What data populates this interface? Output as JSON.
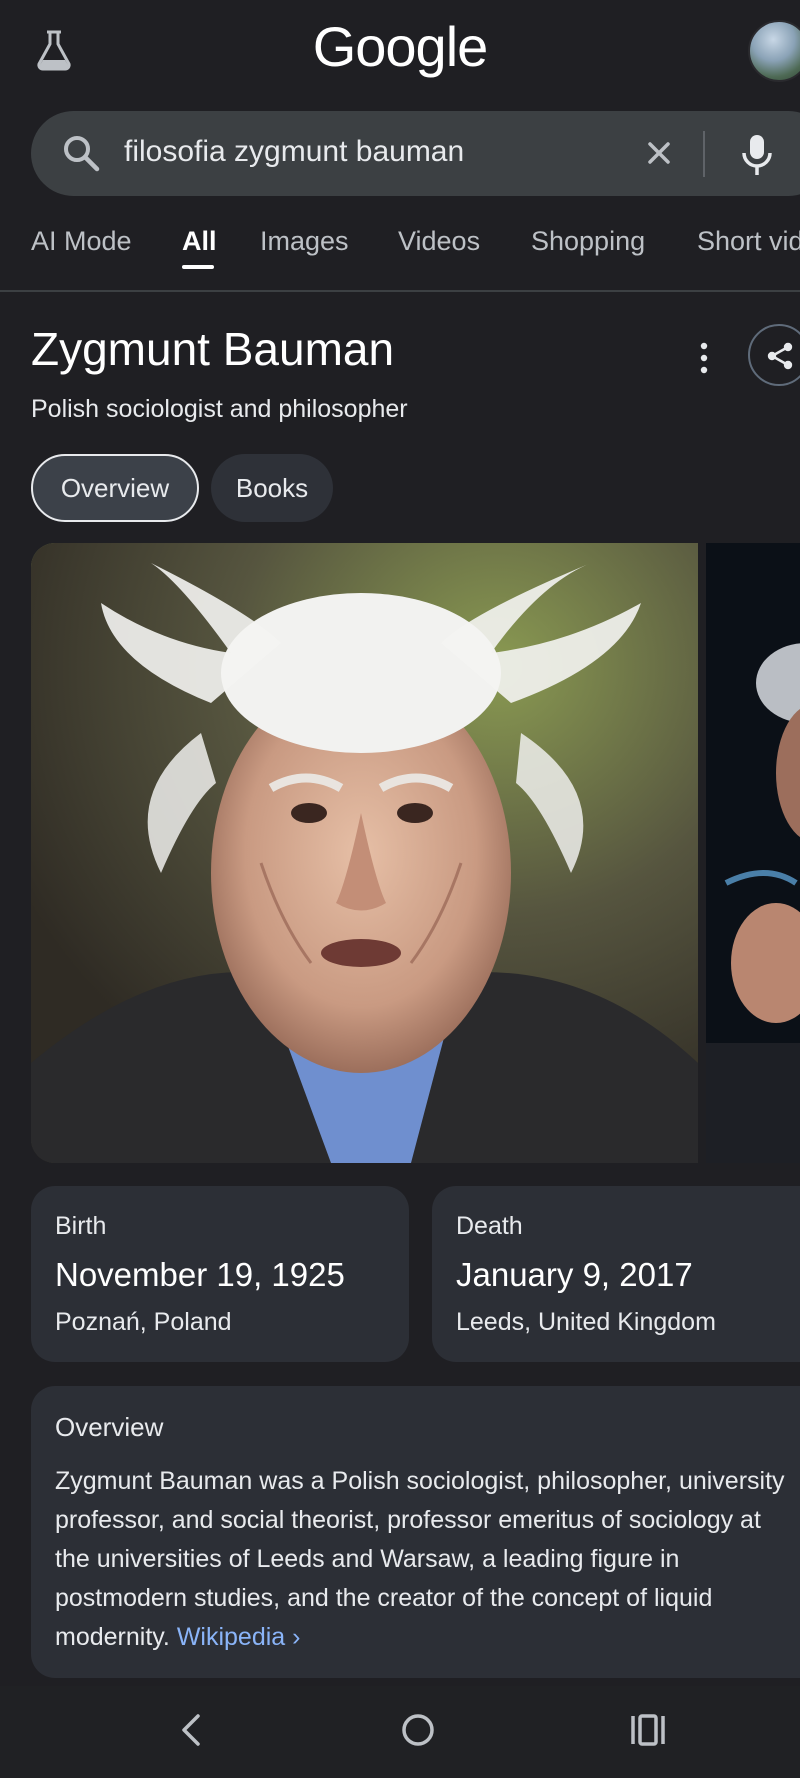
{
  "header": {
    "logo": "Google",
    "lab_icon": "flask-icon",
    "avatar": "user-avatar"
  },
  "search": {
    "query": "filosofia zygmunt bauman",
    "search_icon": "search-icon",
    "clear_icon": "close-icon",
    "mic_icon": "microphone-icon"
  },
  "tabs": [
    {
      "label": "AI Mode"
    },
    {
      "label": "All",
      "active": true
    },
    {
      "label": "Images"
    },
    {
      "label": "Videos"
    },
    {
      "label": "Shopping"
    },
    {
      "label": "Short vid"
    }
  ],
  "knowledge_panel": {
    "title": "Zygmunt Bauman",
    "subtitle": "Polish sociologist and philosopher",
    "chips": [
      {
        "label": "Overview",
        "selected": true
      },
      {
        "label": "Books"
      }
    ],
    "facts": {
      "birth": {
        "label": "Birth",
        "date": "November 19, 1925",
        "place": "Poznań, Poland"
      },
      "death": {
        "label": "Death",
        "date": "January 9, 2017",
        "place": "Leeds, United Kingdom"
      }
    },
    "overview": {
      "title": "Overview",
      "text": "Zygmunt Bauman was a Polish sociologist, philosopher, university professor, and social theorist, professor emeritus of sociology at the universities of Leeds and Warsaw, a leading figure in postmodern studies, and the creator of the concept of liquid modernity.",
      "source_link": "Wikipedia",
      "source_arrow": "›"
    }
  },
  "colors": {
    "background": "#1f1f23",
    "card": "#2c2f36",
    "link": "#8ab4f8",
    "search_box": "#3c4043"
  },
  "navbar": {
    "back_icon": "back-icon",
    "home_icon": "home-icon",
    "recents_icon": "recents-icon"
  }
}
